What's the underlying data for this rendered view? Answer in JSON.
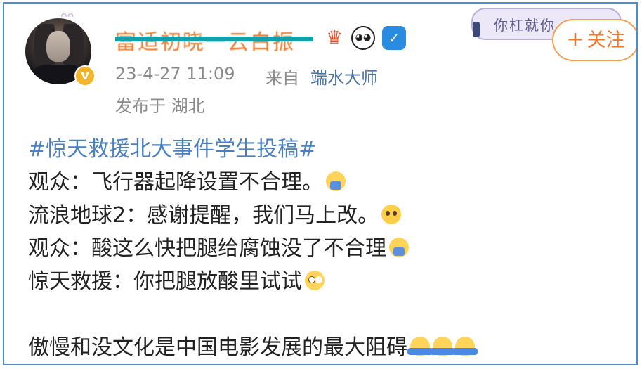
{
  "post": {
    "author": {
      "name": "富适初晓一云白振",
      "avatar_icon": "avatar-icon",
      "verified_icon": "verified-v-icon",
      "verified_glyph": "V",
      "badges": [
        "crown-icon",
        "panda-icon",
        "shield-icon"
      ],
      "crown_glyph": "♛",
      "panda_glyph": "◕◕",
      "shield_glyph": "✓"
    },
    "timestamp": "23-4-27 11:09",
    "source_label": "来自",
    "source_name": "端水大师",
    "location": "发布于 湖北",
    "decoration_text": "你杠就你",
    "follow_button": {
      "plus": "+",
      "label": "关注"
    },
    "lines": [
      {
        "hashtag": "#惊天救援北大事件学生投稿#"
      },
      {
        "text": "观众：飞行器起降设置不合理。",
        "emoji": "raising-hand-emoji"
      },
      {
        "text": "流浪地球2：感谢提醒，我们马上改。",
        "emoji": "pleading-face-emoji"
      },
      {
        "text": "观众：酸这么快把腿给腐蚀没了不合理",
        "emoji": "raising-hand-emoji"
      },
      {
        "text": "惊天救援：你把腿放酸里试试",
        "emoji": "eye-roll-emoji"
      },
      {
        "text": "傲慢和没文化是中国电影发展的最大阻碍",
        "emoji": "shrug-emoji"
      }
    ]
  },
  "colors": {
    "accent_orange": "#f07a2a",
    "link_blue": "#4a7fc0",
    "meta_gray": "#8a8a8a",
    "frame_blue": "#4a8fd6",
    "redaction_teal": "#13a0a8"
  }
}
